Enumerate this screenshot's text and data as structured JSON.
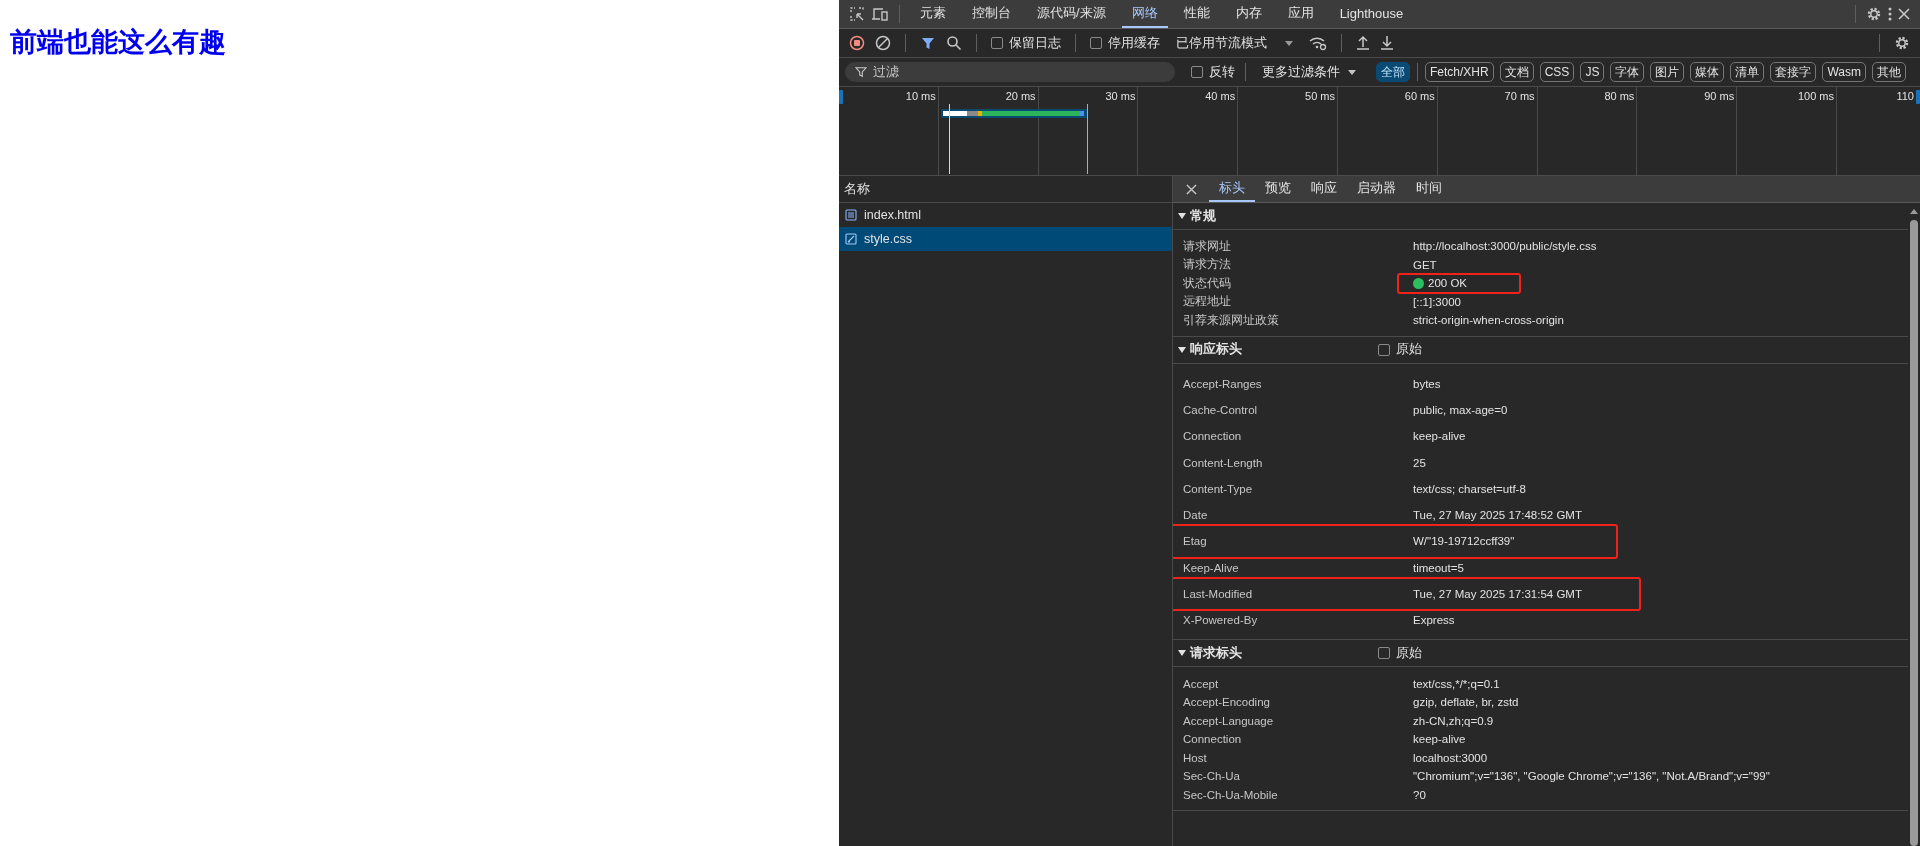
{
  "page": {
    "heading": "前端也能这么有趣"
  },
  "devtools": {
    "panel_tabs": [
      {
        "label": "元素",
        "selected": false
      },
      {
        "label": "控制台",
        "selected": false
      },
      {
        "label": "源代码/来源",
        "selected": false
      },
      {
        "label": "网络",
        "selected": true
      },
      {
        "label": "性能",
        "selected": false
      },
      {
        "label": "内存",
        "selected": false
      },
      {
        "label": "应用",
        "selected": false
      },
      {
        "label": "Lighthouse",
        "selected": false
      }
    ],
    "toolbar": {
      "recording": true,
      "filter_active": true,
      "preserve_log": {
        "label": "保留日志",
        "checked": false
      },
      "disable_cache": {
        "label": "停用缓存",
        "checked": false
      },
      "throttling": "已停用节流模式"
    },
    "filter": {
      "placeholder": "过滤",
      "invert": {
        "label": "反转",
        "checked": false
      },
      "more_filters": "更多过滤条件",
      "types": [
        {
          "label": "全部",
          "selected": true
        },
        {
          "label": "Fetch/XHR",
          "selected": false
        },
        {
          "label": "文档",
          "selected": false
        },
        {
          "label": "CSS",
          "selected": false
        },
        {
          "label": "JS",
          "selected": false
        },
        {
          "label": "字体",
          "selected": false
        },
        {
          "label": "图片",
          "selected": false
        },
        {
          "label": "媒体",
          "selected": false
        },
        {
          "label": "清单",
          "selected": false
        },
        {
          "label": "套接字",
          "selected": false
        },
        {
          "label": "Wasm",
          "selected": false
        },
        {
          "label": "其他",
          "selected": false
        }
      ]
    },
    "timeline": {
      "ticks": [
        "10 ms",
        "20 ms",
        "30 ms",
        "40 ms",
        "50 ms",
        "60 ms",
        "70 ms",
        "80 ms",
        "90 ms",
        "100 ms",
        "110"
      ]
    },
    "requests": {
      "header": "名称",
      "items": [
        {
          "name": "index.html",
          "kind": "document",
          "selected": false
        },
        {
          "name": "style.css",
          "kind": "stylesheet",
          "selected": true
        }
      ]
    },
    "details": {
      "tabs": [
        {
          "label": "标头",
          "selected": true
        },
        {
          "label": "预览",
          "selected": false
        },
        {
          "label": "响应",
          "selected": false
        },
        {
          "label": "启动器",
          "selected": false
        },
        {
          "label": "时间",
          "selected": false
        }
      ],
      "sections": [
        {
          "kind": "general",
          "title": "常规",
          "expanded": true,
          "rows": [
            {
              "name": "请求网址",
              "value": "http://localhost:3000/public/style.css"
            },
            {
              "name": "请求方法",
              "value": "GET"
            },
            {
              "name": "状态代码",
              "value": "200 OK",
              "color": "#2dbe60",
              "highlighted": true
            },
            {
              "name": "远程地址",
              "value": "[::1]:3000"
            },
            {
              "name": "引荐来源网址政策",
              "value": "strict-origin-when-cross-origin"
            }
          ]
        },
        {
          "kind": "headers",
          "title": "响应标头",
          "expanded": true,
          "raw": {
            "label": "原始",
            "checked": false
          },
          "rows": [
            {
              "name": "Accept-Ranges",
              "value": "bytes"
            },
            {
              "name": "Cache-Control",
              "value": "public, max-age=0"
            },
            {
              "name": "Connection",
              "value": "keep-alive"
            },
            {
              "name": "Content-Length",
              "value": "25"
            },
            {
              "name": "Content-Type",
              "value": "text/css; charset=utf-8"
            },
            {
              "name": "Date",
              "value": "Tue, 27 May 2025 17:48:52 GMT"
            },
            {
              "name": "Etag",
              "value": "W/\"19-19712ccff39\"",
              "highlighted": true
            },
            {
              "name": "Keep-Alive",
              "value": "timeout=5"
            },
            {
              "name": "Last-Modified",
              "value": "Tue, 27 May 2025 17:31:54 GMT",
              "highlighted": true
            },
            {
              "name": "X-Powered-By",
              "value": "Express"
            }
          ]
        },
        {
          "kind": "general",
          "title": "请求标头",
          "expanded": true,
          "raw": {
            "label": "原始",
            "checked": false
          },
          "rows": [
            {
              "name": "Accept",
              "value": "text/css,*/*;q=0.1"
            },
            {
              "name": "Accept-Encoding",
              "value": "gzip, deflate, br, zstd"
            },
            {
              "name": "Accept-Language",
              "value": "zh-CN,zh;q=0.9"
            },
            {
              "name": "Connection",
              "value": "keep-alive"
            },
            {
              "name": "Host",
              "value": "localhost:3000"
            },
            {
              "name": "Sec-Ch-Ua",
              "value": "\"Chromium\";v=\"136\", \"Google Chrome\";v=\"136\", \"Not.A/Brand\";v=\"99\""
            },
            {
              "name": "Sec-Ch-Ua-Mobile",
              "value": "?0"
            }
          ]
        }
      ]
    }
  }
}
